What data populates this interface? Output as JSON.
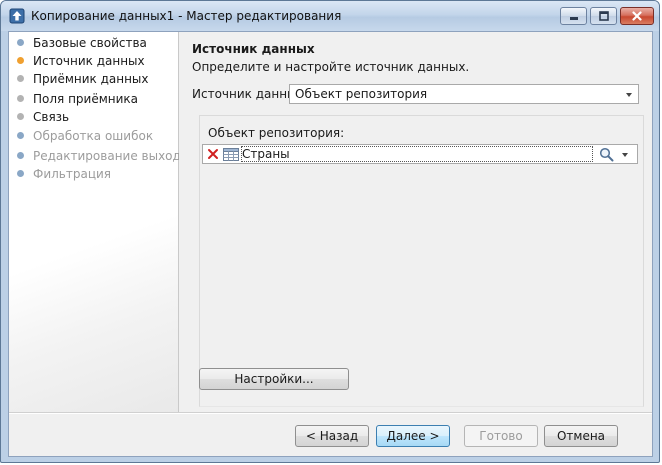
{
  "window": {
    "title": "Копирование данных1 - Мастер редактирования"
  },
  "nav": {
    "items": [
      {
        "label": "Базовые свойства",
        "color": "#8aa7c6",
        "state": "done"
      },
      {
        "label": "Источник данных",
        "color": "#f0a030",
        "state": "current"
      },
      {
        "label": "Приёмник данных",
        "color": "#b3b3b3",
        "state": "pending"
      },
      {
        "label": "Поля приёмника",
        "color": "#b3b3b3",
        "state": "pending"
      },
      {
        "label": "Связь",
        "color": "#b3b3b3",
        "state": "pending"
      },
      {
        "label": "Обработка ошибок",
        "color": "#8aa7c6",
        "state": "disabled"
      },
      {
        "label": "Редактирование выхода",
        "color": "#8aa7c6",
        "state": "disabled"
      },
      {
        "label": "Фильтрация",
        "color": "#8aa7c6",
        "state": "disabled"
      }
    ]
  },
  "section": {
    "title": "Источник данных",
    "subtitle": "Определите и настройте источник данных."
  },
  "source": {
    "label": "Источник данных:",
    "value": "Объект репозитория"
  },
  "repository": {
    "label": "Объект репозитория:",
    "value": "Страны",
    "icons": [
      "clear-icon",
      "table-icon",
      "search-icon",
      "chevron-down-icon"
    ]
  },
  "buttons": {
    "settings": "Настройки...",
    "back": "< Назад",
    "next": "Далее >",
    "finish": "Готово",
    "cancel": "Отмена"
  },
  "colors": {
    "disabled_text": "#9c9c9c",
    "default_button": "#3c7fb1"
  }
}
